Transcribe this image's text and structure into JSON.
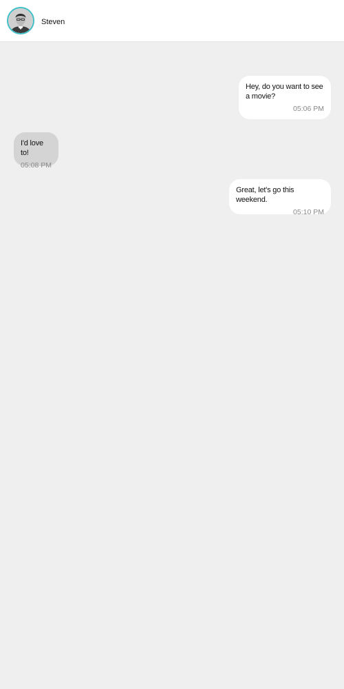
{
  "contact": {
    "name": "Steven",
    "avatar_icon": "person-photo-avatar",
    "avatar_ring_color": "#3fc1c9"
  },
  "messages": [
    {
      "direction": "outgoing",
      "text": "Hey, do you want to see a movie?",
      "time": "05:06 PM"
    },
    {
      "direction": "incoming",
      "text": "I'd love to!",
      "time": "05:08 PM"
    },
    {
      "direction": "outgoing",
      "text": "Great, let's go this weekend.",
      "time": "05:10 PM"
    }
  ],
  "colors": {
    "outgoing_bubble": "#ffffff",
    "incoming_bubble": "#d4d4d4",
    "chat_background": "#efefef"
  }
}
